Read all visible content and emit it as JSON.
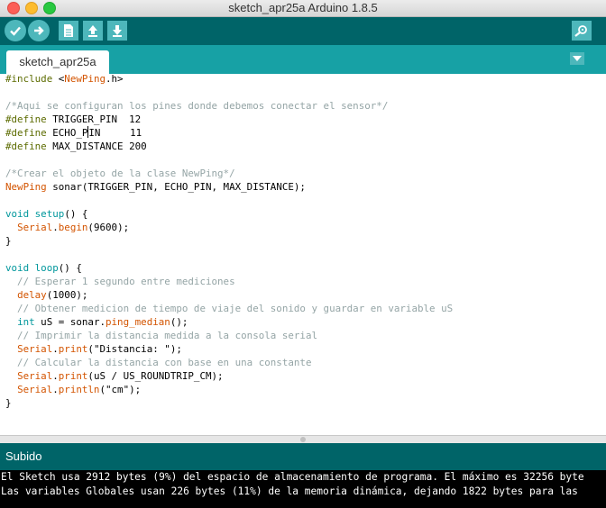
{
  "window": {
    "title": "sketch_apr25a Arduino 1.8.5"
  },
  "toolbar": {
    "buttons": [
      {
        "icon": "check-icon",
        "action": "verify"
      },
      {
        "icon": "arrow-right-icon",
        "action": "upload"
      },
      {
        "icon": "new-file-icon",
        "action": "new"
      },
      {
        "icon": "arrow-up-icon",
        "action": "open"
      },
      {
        "icon": "arrow-down-icon",
        "action": "save"
      },
      {
        "icon": "serial-monitor-icon",
        "action": "serial-monitor"
      }
    ]
  },
  "tabs": [
    {
      "label": "sketch_apr25a"
    }
  ],
  "colors": {
    "toolbar": "#006468",
    "tabbar": "#17a1a5",
    "button": "#4db7bb",
    "comment": "#95a5a6",
    "function": "#d35400",
    "type": "#00979c",
    "preprocessor": "#5e6d03"
  },
  "code": {
    "lines": [
      [
        {
          "t": "#include",
          "c": "kw-pre"
        },
        {
          "t": " <",
          "c": "plain"
        },
        {
          "t": "NewPing",
          "c": "kw-lib"
        },
        {
          "t": ".h>",
          "c": "plain"
        }
      ],
      [],
      [
        {
          "t": "/*Aqui se configuran los pines donde debemos conectar el sensor*/",
          "c": "comment"
        }
      ],
      [
        {
          "t": "#define",
          "c": "kw-pre"
        },
        {
          "t": " TRIGGER_PIN  12",
          "c": "plain"
        }
      ],
      [
        {
          "t": "#define",
          "c": "kw-pre"
        },
        {
          "t": " ECHO_P",
          "c": "plain"
        },
        {
          "t": "",
          "c": "caret"
        },
        {
          "t": "IN     11",
          "c": "plain"
        }
      ],
      [
        {
          "t": "#define",
          "c": "kw-pre"
        },
        {
          "t": " MAX_DISTANCE 200",
          "c": "plain"
        }
      ],
      [],
      [
        {
          "t": "/*Crear el objeto de la clase NewPing*/",
          "c": "comment"
        }
      ],
      [
        {
          "t": "NewPing",
          "c": "kw-lib"
        },
        {
          "t": " sonar(TRIGGER_PIN, ECHO_PIN, MAX_DISTANCE);",
          "c": "plain"
        }
      ],
      [],
      [
        {
          "t": "void",
          "c": "kw-type"
        },
        {
          "t": " ",
          "c": "plain"
        },
        {
          "t": "setup",
          "c": "kw-type"
        },
        {
          "t": "() {",
          "c": "plain"
        }
      ],
      [
        {
          "t": "  ",
          "c": "plain"
        },
        {
          "t": "Serial",
          "c": "kw-fn"
        },
        {
          "t": ".",
          "c": "plain"
        },
        {
          "t": "begin",
          "c": "kw-fn"
        },
        {
          "t": "(9600);",
          "c": "plain"
        }
      ],
      [
        {
          "t": "}",
          "c": "plain"
        }
      ],
      [],
      [
        {
          "t": "void",
          "c": "kw-type"
        },
        {
          "t": " ",
          "c": "plain"
        },
        {
          "t": "loop",
          "c": "kw-type"
        },
        {
          "t": "() {",
          "c": "plain"
        }
      ],
      [
        {
          "t": "  // Esperar 1 segundo entre mediciones",
          "c": "comment"
        }
      ],
      [
        {
          "t": "  ",
          "c": "plain"
        },
        {
          "t": "delay",
          "c": "kw-fn"
        },
        {
          "t": "(1000);",
          "c": "plain"
        }
      ],
      [
        {
          "t": "  // Obtener medicion de tiempo de viaje del sonido y guardar en variable uS",
          "c": "comment"
        }
      ],
      [
        {
          "t": "  ",
          "c": "plain"
        },
        {
          "t": "int",
          "c": "kw-type"
        },
        {
          "t": " uS = sonar.",
          "c": "plain"
        },
        {
          "t": "ping_median",
          "c": "kw-fn"
        },
        {
          "t": "();",
          "c": "plain"
        }
      ],
      [
        {
          "t": "  // Imprimir la distancia medida a la consola serial",
          "c": "comment"
        }
      ],
      [
        {
          "t": "  ",
          "c": "plain"
        },
        {
          "t": "Serial",
          "c": "kw-fn"
        },
        {
          "t": ".",
          "c": "plain"
        },
        {
          "t": "print",
          "c": "kw-fn"
        },
        {
          "t": "(\"Distancia: \");",
          "c": "plain"
        }
      ],
      [
        {
          "t": "  // Calcular la distancia con base en una constante",
          "c": "comment"
        }
      ],
      [
        {
          "t": "  ",
          "c": "plain"
        },
        {
          "t": "Serial",
          "c": "kw-fn"
        },
        {
          "t": ".",
          "c": "plain"
        },
        {
          "t": "print",
          "c": "kw-fn"
        },
        {
          "t": "(uS / US_ROUNDTRIP_CM);",
          "c": "plain"
        }
      ],
      [
        {
          "t": "  ",
          "c": "plain"
        },
        {
          "t": "Serial",
          "c": "kw-fn"
        },
        {
          "t": ".",
          "c": "plain"
        },
        {
          "t": "println",
          "c": "kw-fn"
        },
        {
          "t": "(\"cm\");",
          "c": "plain"
        }
      ],
      [
        {
          "t": "}",
          "c": "plain"
        }
      ]
    ]
  },
  "status": {
    "text": "Subido"
  },
  "console": {
    "lines": [
      "El Sketch usa 2912 bytes (9%) del espacio de almacenamiento de programa. El máximo es 32256 byte",
      "Las variables Globales usan 226 bytes (11%) de la memoria dinámica, dejando 1822 bytes para las"
    ]
  }
}
